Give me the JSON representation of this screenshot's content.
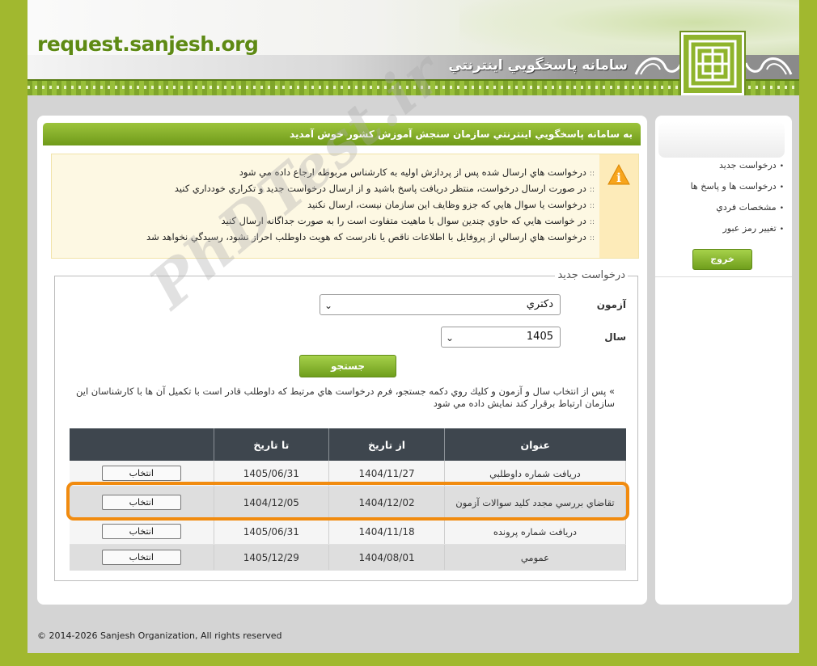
{
  "header": {
    "site_url": "request.sanjesh.org",
    "system_title": "سامانه پاسخگويي اينترنتي"
  },
  "main": {
    "welcome": "به سامانه پاسخگويي اينترنتي سازمان سنجش آموزش كشور خوش آمديد",
    "notices": [
      "درخواست هاي ارسال شده پس از پردازش اوليه به كارشناس مربوطه ارجاع داده مي شود",
      "در صورت ارسال درخواست، منتظر دريافت پاسخ باشيد و از ارسال درخواست جديد و تكراري خودداري كنيد",
      "درخواست يا سوال هايي كه جزو وظايف اين سازمان نيست، ارسال نكنيد",
      "در خواست هايي كه حاوي چندين سوال با ماهيت متفاوت است را به صورت جداگانه ارسال كنيد",
      "درخواست هاي ارسالي از پروفايل با اطلاعات ناقص يا نادرست كه هويت داوطلب احراز نشود، رسيدگي نخواهد شد"
    ],
    "form": {
      "legend": "درخواست جديد",
      "exam_label": "آزمون",
      "exam_value": "دكتري",
      "year_label": "سال",
      "year_value": "1405",
      "search_label": "جستجو",
      "help": "» پس از انتخاب سال و آزمون و كليك روي دكمه جستجو، فرم درخواست هاي مرتبط كه داوطلب قادر است با تكميل آن ها با كارشناسان اين سازمان ارتباط برقرار كند نمايش داده مي شود"
    },
    "table": {
      "headers": [
        "عنوان",
        "از تاريخ",
        "تا تاريخ",
        ""
      ],
      "rows": [
        {
          "title": "دريافت شماره داوطلبي",
          "from": "1404/11/27",
          "to": "1405/06/31",
          "action": "انتخاب"
        },
        {
          "title": "تقاضاي بررسي مجدد كليد سوالات آزمون",
          "from": "1404/12/02",
          "to": "1404/12/05",
          "action": "انتخاب"
        },
        {
          "title": "دريافت شماره پرونده",
          "from": "1404/11/18",
          "to": "1405/06/31",
          "action": "انتخاب"
        },
        {
          "title": "عمومي",
          "from": "1404/08/01",
          "to": "1405/12/29",
          "action": "انتخاب"
        }
      ]
    }
  },
  "sidebar": {
    "items": [
      "درخواست جديد",
      "درخواست ها و پاسخ ها",
      "مشخصات فردي",
      "تغيير رمز عبور"
    ],
    "logout": "خروج"
  },
  "footer": "© 2014-2026 Sanjesh Organization, All rights reserved",
  "watermark": "PhDTest.ir",
  "colors": {
    "brand_green": "#8fb42c",
    "highlight_orange": "#f18b0f",
    "table_header": "#3e464e"
  }
}
